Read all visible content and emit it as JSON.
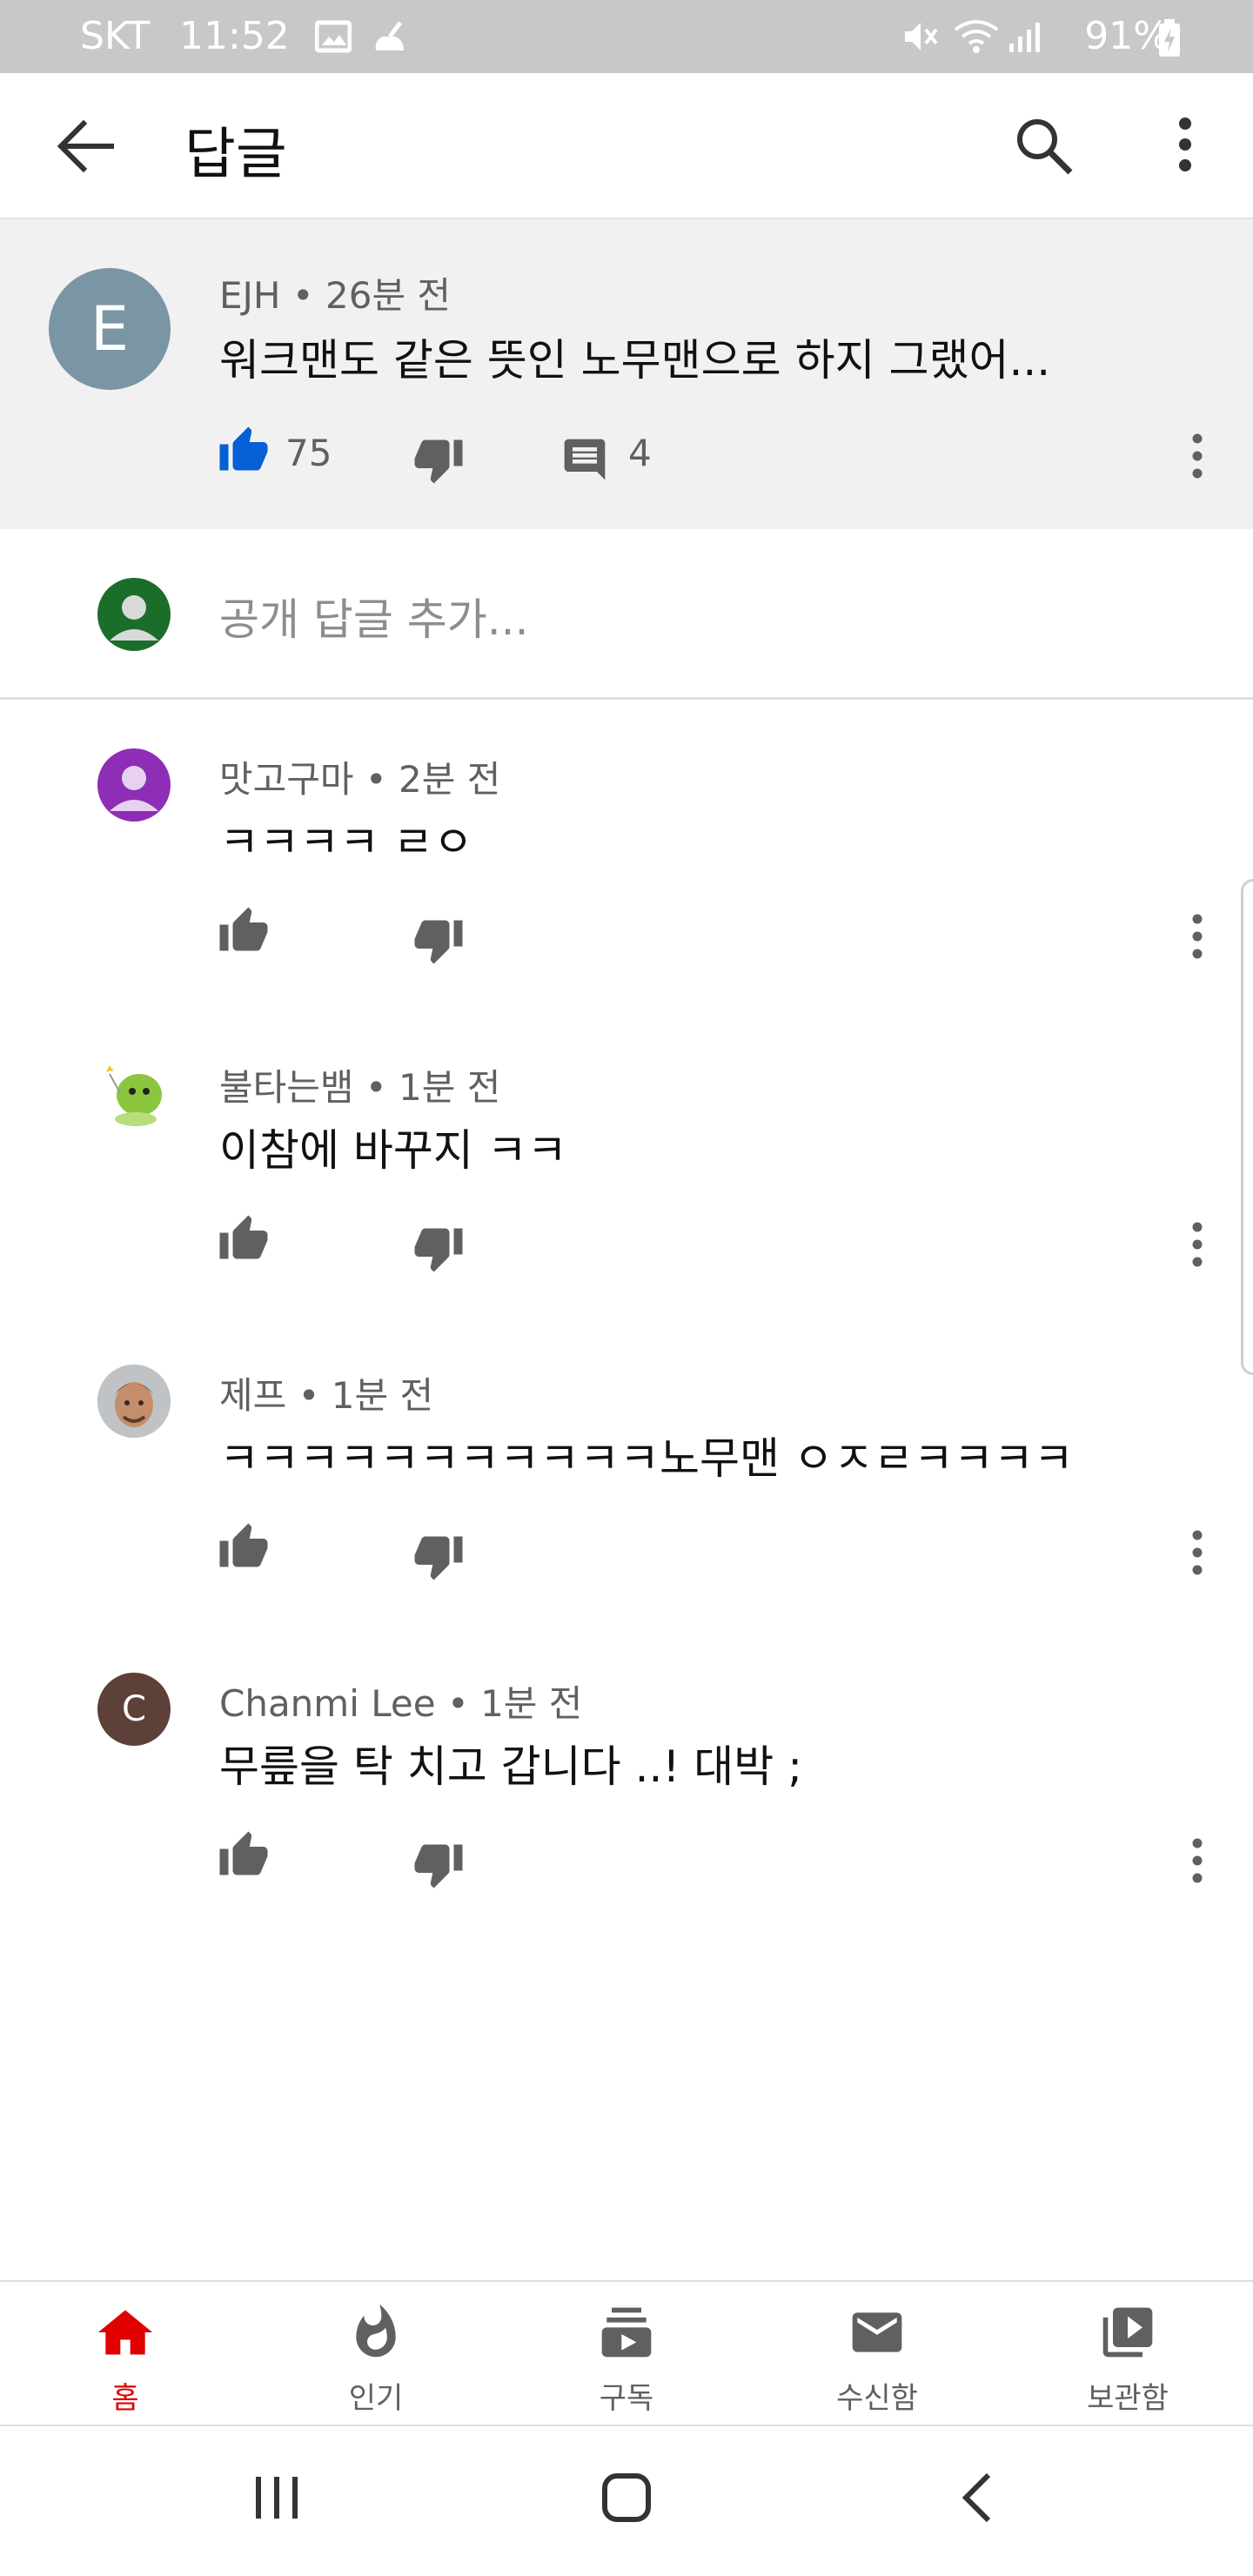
{
  "status_bar": {
    "carrier": "SKT",
    "time": "11:52",
    "battery": "91%",
    "icons": [
      "gallery-icon",
      "cleaner-icon",
      "mute-icon",
      "wifi-icon",
      "signal-icon",
      "battery-charging-icon"
    ]
  },
  "app_bar": {
    "title": "답글",
    "icons": [
      "back-arrow-icon",
      "search-icon",
      "more-vert-icon"
    ]
  },
  "parent_comment": {
    "avatar_letter": "E",
    "avatar_color": "#7a95a4",
    "author": "EJH",
    "time": "26분 전",
    "text": "워크맨도 같은 뜻인 노무맨으로 하지 그랬어...",
    "likes": "75",
    "replies": "4",
    "liked": true
  },
  "add_reply": {
    "placeholder": "공개 답글 추가..."
  },
  "replies": [
    {
      "author": "맛고구마",
      "time": "2분 전",
      "text": "ㅋㅋㅋㅋ ㄹㅇ",
      "avatar_type": "default-purple"
    },
    {
      "author": "불타는뱀",
      "time": "1분 전",
      "text": "이참에 바꾸지 ㅋㅋ",
      "avatar_type": "green-cartoon"
    },
    {
      "author": "제프",
      "time": "1분 전",
      "text": "ㅋㅋㅋㅋㅋㅋㅋㅋㅋㅋㅋ노무맨 ㅇㅈㄹㅋㅋㅋㅋ",
      "avatar_type": "photo"
    },
    {
      "author": "Chanmi Lee",
      "time": "1분 전",
      "text": "무릎을 탁 치고 갑니다 ..! 대박 ;",
      "avatar_type": "letter",
      "avatar_letter": "C"
    }
  ],
  "bottom_nav": [
    {
      "label": "홈",
      "icon": "home-icon",
      "active": true
    },
    {
      "label": "인기",
      "icon": "trending-icon",
      "active": false
    },
    {
      "label": "구독",
      "icon": "subscriptions-icon",
      "active": false
    },
    {
      "label": "수신함",
      "icon": "inbox-icon",
      "active": false
    },
    {
      "label": "보관함",
      "icon": "library-icon",
      "active": false
    }
  ],
  "colors": {
    "accent_red": "#e00000",
    "like_blue": "#065fd4",
    "icon_gray": "#606060"
  }
}
